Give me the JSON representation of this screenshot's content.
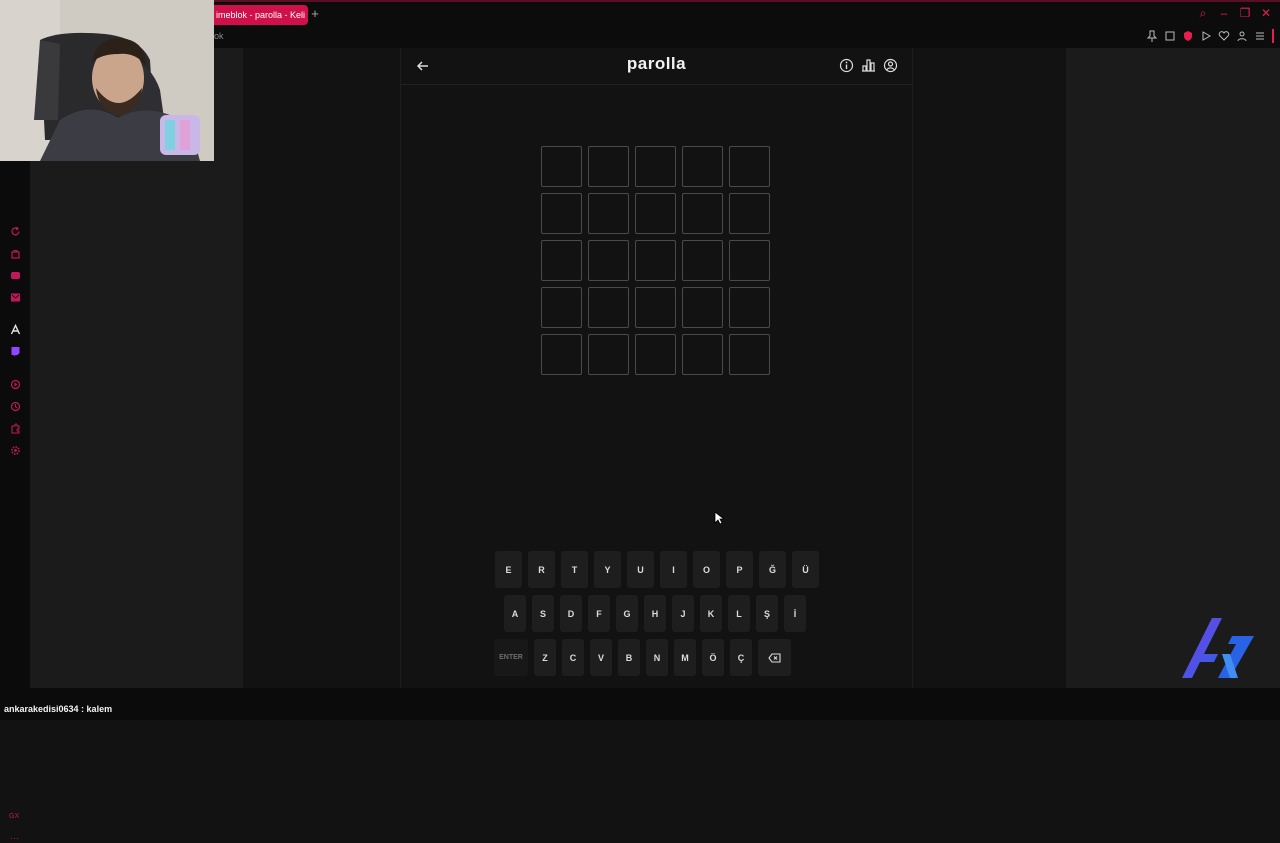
{
  "browser": {
    "tab_title": "imeblok - parolla - Keli",
    "new_tab": "+",
    "url_fragment": "ok"
  },
  "game": {
    "title": "parolla",
    "rows": 5,
    "cols": 5,
    "keyboard": {
      "row1": [
        "E",
        "R",
        "T",
        "Y",
        "U",
        "I",
        "O",
        "P",
        "Ğ",
        "Ü"
      ],
      "row2": [
        "A",
        "S",
        "D",
        "F",
        "G",
        "H",
        "J",
        "K",
        "L",
        "Ş",
        "İ"
      ],
      "row3": [
        "ENTER",
        "Z",
        "C",
        "V",
        "B",
        "N",
        "M",
        "Ö",
        "Ç"
      ]
    }
  },
  "sidebar": {
    "footer_text": "GX",
    "more_text": "···"
  },
  "chat": {
    "message": "ankarakedisi0634 : kalem"
  },
  "colors": {
    "accent": "#e81e4f",
    "tab": "#d0104a",
    "logo_blue": "#2a62e6",
    "logo_purple": "#7b3fe4"
  },
  "icons": [
    "back-arrow-icon",
    "info-icon",
    "stats-icon",
    "account-icon",
    "backspace-icon",
    "search-icon",
    "pin-icon",
    "heart-icon",
    "play-icon",
    "menu-icon",
    "mouse-cursor-icon"
  ]
}
